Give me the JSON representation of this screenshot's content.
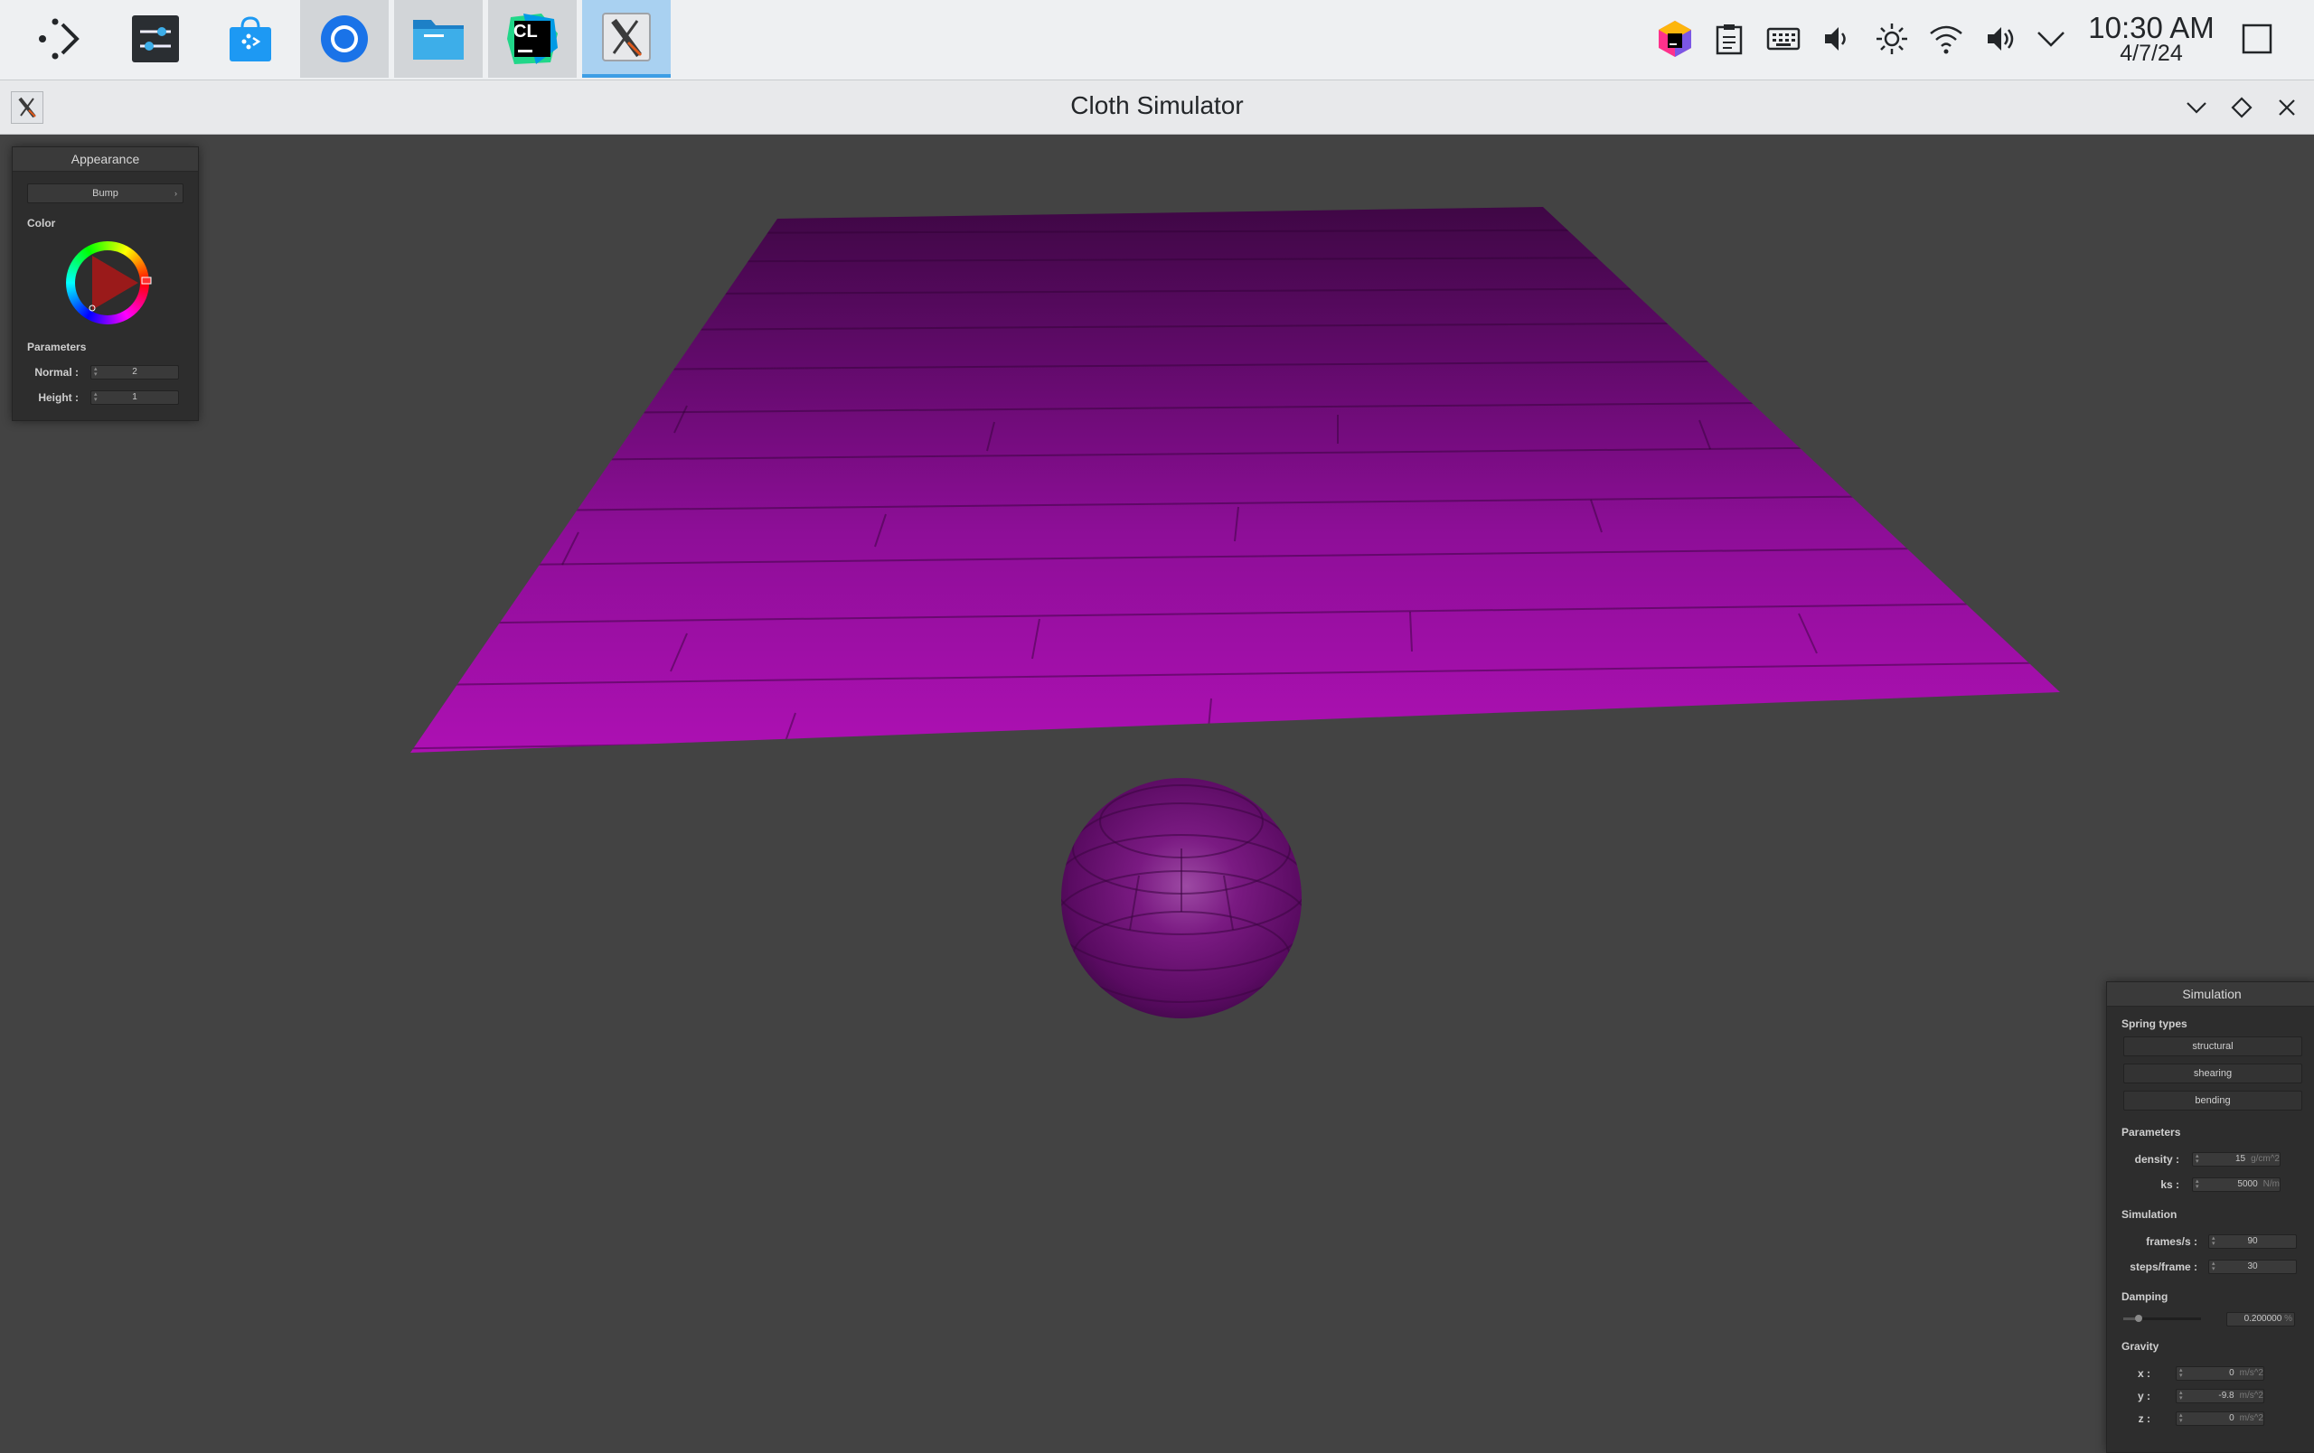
{
  "taskbar": {
    "apps": [
      {
        "name": "application-launcher",
        "state": "normal"
      },
      {
        "name": "system-settings",
        "state": "normal"
      },
      {
        "name": "discover-store",
        "state": "normal"
      },
      {
        "name": "chromium-browser",
        "state": "open"
      },
      {
        "name": "file-manager",
        "state": "open"
      },
      {
        "name": "clion-ide",
        "state": "open"
      },
      {
        "name": "cloth-simulator",
        "state": "active"
      }
    ],
    "clion_label": "CL",
    "clock": {
      "time": "10:30 AM",
      "date": "4/7/24"
    }
  },
  "window": {
    "title": "Cloth Simulator"
  },
  "appearance": {
    "title": "Appearance",
    "shader": "Bump",
    "color_label": "Color",
    "color_value": "#d60fd6",
    "parameters_label": "Parameters",
    "normal_label": "Normal :",
    "normal_value": "2",
    "height_label": "Height :",
    "height_value": "1"
  },
  "simulation": {
    "title": "Simulation",
    "spring_types_label": "Spring types",
    "spring_types": [
      "structural",
      "shearing",
      "bending"
    ],
    "parameters_label": "Parameters",
    "density_label": "density :",
    "density_value": "15",
    "density_unit": "g/cm^2",
    "ks_label": "ks :",
    "ks_value": "5000",
    "ks_unit": "N/m",
    "simulation_label": "Simulation",
    "fps_label": "frames/s :",
    "fps_value": "90",
    "steps_label": "steps/frame :",
    "steps_value": "30",
    "damping_label": "Damping",
    "damping_value": "0.200000",
    "damping_unit": "%",
    "damping_level": 0.2,
    "gravity_label": "Gravity",
    "gx_label": "x :",
    "gx_value": "0",
    "gy_label": "y :",
    "gy_value": "-9.8",
    "gz_label": "z :",
    "gz_value": "0",
    "gravity_unit": "m/s^2"
  },
  "scene": {
    "cloth_color": "#b010b4",
    "sphere_color": "#7a1480",
    "background": "#434343"
  }
}
